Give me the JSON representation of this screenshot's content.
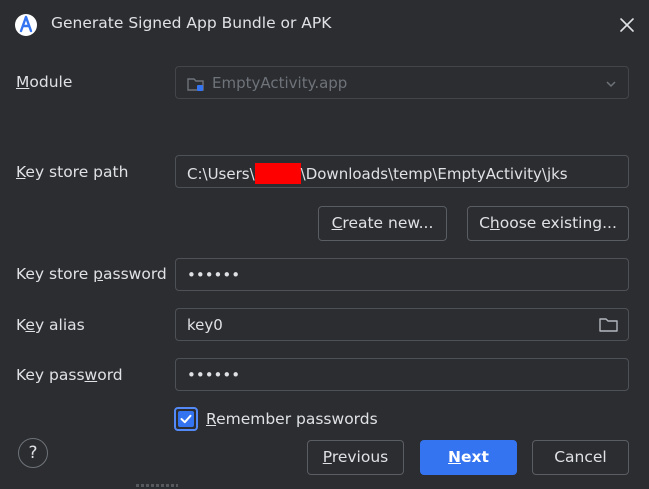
{
  "window": {
    "title": "Generate Signed App Bundle or APK"
  },
  "module": {
    "label_first": "M",
    "label_rest": "odule",
    "value": "EmptyActivity.app"
  },
  "key_store_path": {
    "label_first": "K",
    "label_rest": "ey store path",
    "value_prefix": "C:\\Users\\",
    "value_suffix": "\\Downloads\\temp\\EmptyActivity\\jks"
  },
  "buttons": {
    "create_new_first": "C",
    "create_new_rest": "reate new...",
    "choose_existing_pre": "C",
    "choose_existing_mn": "h",
    "choose_existing_rest": "oose existing...",
    "previous_first": "P",
    "previous_rest": "revious",
    "next_first": "N",
    "next_rest": "ext",
    "cancel": "Cancel"
  },
  "key_store_password": {
    "label_pre": "Key store ",
    "label_mn": "p",
    "label_rest": "assword",
    "value": "••••••"
  },
  "key_alias": {
    "label_pre": "K",
    "label_mn": "e",
    "label_rest": "y alias",
    "value": "key0"
  },
  "key_password": {
    "label_pre": "Key pass",
    "label_mn": "w",
    "label_rest": "ord",
    "value": "••••••"
  },
  "remember": {
    "label_first": "R",
    "label_rest": "emember passwords",
    "checked": true
  },
  "help": {
    "symbol": "?"
  },
  "colors": {
    "background": "#2b2d30",
    "primary_button": "#3574f0",
    "checkbox_border": "#548af7",
    "redaction": "#ff0000"
  },
  "icons": {
    "title": "android-studio-icon",
    "close": "close-icon",
    "module": "module-folder-icon",
    "dropdown": "chevron-down-icon",
    "folder": "folder-icon",
    "checkbox": "checkmark-icon"
  }
}
